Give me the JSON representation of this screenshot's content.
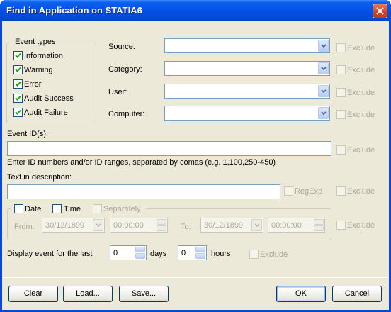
{
  "window": {
    "title": "Find in Application on STATIA6"
  },
  "event_types": {
    "title": "Event types",
    "items": [
      {
        "label": "Information",
        "checked": true
      },
      {
        "label": "Warning",
        "checked": true
      },
      {
        "label": "Error",
        "checked": true
      },
      {
        "label": "Audit Success",
        "checked": true
      },
      {
        "label": "Audit Failure",
        "checked": true
      }
    ]
  },
  "filters": {
    "source_label": "Source:",
    "category_label": "Category:",
    "user_label": "User:",
    "computer_label": "Computer:",
    "source_value": "",
    "category_value": "",
    "user_value": "",
    "computer_value": ""
  },
  "exclude_label": "Exclude",
  "event_id": {
    "label": "Event ID(s):",
    "value": "",
    "hint": "Enter ID numbers and/or ID ranges, separated by comas (e.g. 1,100,250-450)"
  },
  "description": {
    "label": "Text in description:",
    "value": "",
    "regexp_label": "RegExp"
  },
  "date_range": {
    "date_label": "Date",
    "time_label": "Time",
    "separately_label": "Separately",
    "from_label": "From:",
    "to_label": "To:",
    "from_date": "30/12/1899",
    "from_time": "00:00:00",
    "to_date": "30/12/1899",
    "to_time": "00:00:00"
  },
  "last_period": {
    "label": "Display event for the last",
    "days_value": "0",
    "days_label": "days",
    "hours_value": "0",
    "hours_label": "hours"
  },
  "buttons": {
    "clear": "Clear",
    "load": "Load...",
    "save": "Save...",
    "ok": "OK",
    "cancel": "Cancel"
  }
}
